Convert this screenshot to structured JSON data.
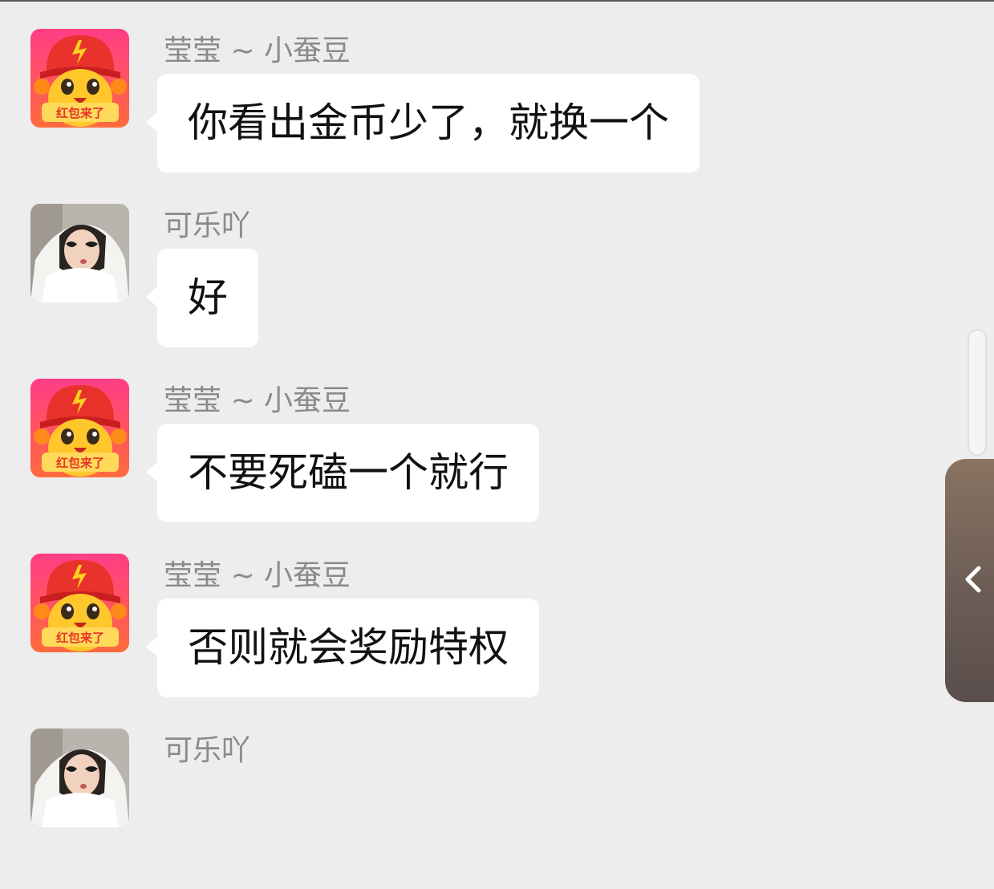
{
  "messages": [
    {
      "sender": "莹莹 ~ 小蚕豆",
      "text": "你看出金币少了，就换一个",
      "avatar": "mascot-red-packet",
      "avatar_caption": "红包来了"
    },
    {
      "sender": "可乐吖",
      "text": "好",
      "avatar": "girl-photo"
    },
    {
      "sender": "莹莹 ~ 小蚕豆",
      "text": "不要死磕一个就行",
      "avatar": "mascot-red-packet",
      "avatar_caption": "红包来了"
    },
    {
      "sender": "莹莹 ~ 小蚕豆",
      "text": "否则就会奖励特权",
      "avatar": "mascot-red-packet",
      "avatar_caption": "红包来了"
    },
    {
      "sender": "可乐吖",
      "text": "",
      "avatar": "girl-photo"
    }
  ],
  "side_panel": {
    "icon": "chevron-left-icon"
  },
  "colors": {
    "background": "#ededed",
    "bubble": "#ffffff",
    "sender": "#8a8a8a",
    "text": "#111111"
  }
}
